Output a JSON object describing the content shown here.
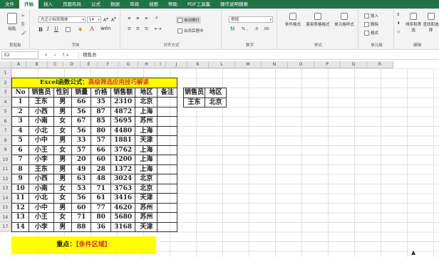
{
  "menu": {
    "tabs": [
      "文件",
      "开始",
      "插入",
      "页面布局",
      "公式",
      "数据",
      "审阅",
      "视图",
      "帮助",
      "PDF工具集",
      "操作说明搜索"
    ],
    "active_tab": "开始"
  },
  "ribbon": {
    "clipboard_label": "剪贴板",
    "paste": "粘贴",
    "font_label": "字体",
    "font_name": "方正小标宋简体",
    "font_size": "14",
    "bold": "B",
    "italic": "I",
    "underline": "U",
    "align_label": "对齐方式",
    "wrap": "自动换行",
    "merge": "合并后居中",
    "number_label": "数字",
    "number_format": "常规",
    "number_symbols": "% ,",
    "styles_label": "样式",
    "cond_format": "条件格式",
    "table_format": "套用表格格式",
    "cell_style": "单元格样式",
    "cells_label": "单元格",
    "insert": "插入",
    "delete": "删除",
    "format": "格式",
    "edit_label": "编辑",
    "sort_filter": "排序和筛选",
    "find_select": "查找和选择"
  },
  "formula_bar": {
    "name_box": "E2",
    "fx": "× ✓ fx",
    "value": "销售员"
  },
  "columns": [
    "A",
    "B",
    "C",
    "D",
    "E",
    "F",
    "G",
    "H",
    "I",
    "J",
    "K",
    "L",
    "M",
    "N",
    "O",
    "P",
    "Q",
    "R"
  ],
  "rows": [
    "1",
    "2",
    "3",
    "4",
    "5",
    "6",
    "7",
    "8",
    "9",
    "10",
    "11",
    "12",
    "13",
    "14",
    "15",
    "16",
    "17"
  ],
  "sheet": {
    "title_prefix": "Excel函数公式：",
    "title_highlight": "高级筛选应用技巧解读",
    "headers": [
      "No",
      "销售员",
      "性别",
      "销量",
      "价格",
      "销售额",
      "地区",
      "备注"
    ],
    "data": [
      [
        "1",
        "王东",
        "男",
        "66",
        "35",
        "2310",
        "北京",
        ""
      ],
      [
        "2",
        "小西",
        "男",
        "56",
        "87",
        "4872",
        "上海",
        ""
      ],
      [
        "3",
        "小南",
        "女",
        "67",
        "85",
        "5695",
        "苏州",
        ""
      ],
      [
        "4",
        "小北",
        "女",
        "56",
        "80",
        "4480",
        "上海",
        ""
      ],
      [
        "5",
        "小中",
        "男",
        "33",
        "57",
        "1881",
        "天津",
        ""
      ],
      [
        "6",
        "小王",
        "女",
        "57",
        "66",
        "3762",
        "上海",
        ""
      ],
      [
        "7",
        "小李",
        "男",
        "20",
        "60",
        "1200",
        "上海",
        ""
      ],
      [
        "8",
        "王东",
        "男",
        "49",
        "28",
        "1372",
        "上海",
        ""
      ],
      [
        "9",
        "小西",
        "男",
        "63",
        "48",
        "3024",
        "北京",
        ""
      ],
      [
        "10",
        "小南",
        "女",
        "53",
        "71",
        "3763",
        "北京",
        ""
      ],
      [
        "11",
        "小北",
        "女",
        "56",
        "61",
        "3416",
        "天津",
        ""
      ],
      [
        "12",
        "小中",
        "男",
        "60",
        "77",
        "4620",
        "苏州",
        ""
      ],
      [
        "13",
        "小王",
        "女",
        "71",
        "80",
        "5680",
        "苏州",
        ""
      ],
      [
        "14",
        "小李",
        "男",
        "88",
        "36",
        "3168",
        "天津",
        ""
      ]
    ],
    "footer_prefix": "重点：",
    "footer_highlight": "【条件区域】"
  },
  "criteria": {
    "headers": [
      "销售员",
      "地区"
    ],
    "values": [
      "王东",
      "北京"
    ]
  }
}
